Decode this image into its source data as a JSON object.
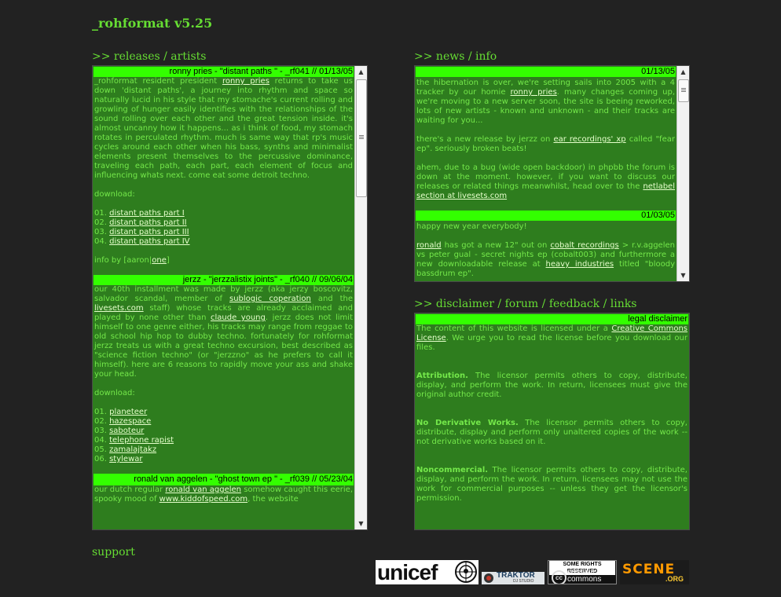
{
  "site": {
    "title": "_rohformat v5.25"
  },
  "sections": {
    "releases": {
      "prefix": ">>",
      "a": "releases",
      "sep": "/",
      "b": "artists"
    },
    "news": {
      "prefix": ">>",
      "a": "news",
      "sep": "/",
      "b": "info"
    },
    "disclaimer": {
      "prefix": ">>",
      "a": "disclaimer",
      "sep1": "/",
      "b": "forum",
      "sep2": "/",
      "c": "feedback",
      "sep3": "/",
      "d": "links"
    }
  },
  "releases": [
    {
      "header": "ronny pries - \"distant paths \" - _rf041 // 01/13/05",
      "p1_a": "_rohformat resident president ",
      "p1_link": "ronny pries",
      "p1_b": " returns to take us down 'distant paths', a journey into rhythm and space so naturally lucid in his style that my stomache's current rolling and growling of hunger easily identifies with the relationships of the sound rolling over each other and the great tension inside. it's almost uncanny how it happens... as i think of food, my stomach rotates in perculated rhythm. much is same way that rp's music cycles around each other when his bass, synths and minimalist elements present themselves to the percussive dominance, traveling each path, each part, each element of focus and influencing whats next. come eat some detroit techno.",
      "download_label": "download:",
      "tracks": [
        {
          "num": "01.",
          "title": "distant paths part I"
        },
        {
          "num": "02.",
          "title": "distant paths part II"
        },
        {
          "num": "03.",
          "title": "distant paths part III"
        },
        {
          "num": "04.",
          "title": "distant paths part IV"
        }
      ],
      "info_a": "info by [aaron|",
      "info_link": "one",
      "info_b": "]"
    },
    {
      "header": "jerzz - \"jerzzalistix joints\" - _rf040 // 09/06/04",
      "p1_a": "our 40th installment was made by jerzz (aka jerzy boscovitz, salvador scandal, member of ",
      "p1_link1": "sublogic coperation",
      "p1_b": " and the ",
      "p1_link2": "livesets.com",
      "p1_c": " staff) whose tracks are already acclaimed and played by none other than ",
      "p1_link3": "claude young",
      "p1_d": ". jerzz does not limit himself to one genre either, his tracks may range from reggae to old school hip hop to dubby techno. fortunately for rohformat jerzz treats us with a great techno excursion, best described as \"science fiction techno\" (or \"jerzzno\" as he prefers to call it himself). here are 6 reasons to rapidly move your ass and shake your head.",
      "download_label": "download:",
      "tracks": [
        {
          "num": "01.",
          "title": "planeteer"
        },
        {
          "num": "02.",
          "title": "hazespace"
        },
        {
          "num": "03.",
          "title": "saboteur"
        },
        {
          "num": "04.",
          "title": "telephone rapist"
        },
        {
          "num": "05.",
          "title": "zamalajtakz"
        },
        {
          "num": "06.",
          "title": "stylewar"
        }
      ]
    },
    {
      "header": "ronald van aggelen - \"ghost town ep \" - _rf039 // 05/23/04",
      "p1_a": "our dutch regular ",
      "p1_link1": "ronald van aggelen",
      "p1_b": " somehow caught this eerie, spooky mood of ",
      "p1_link2": "www.kiddofspeed.com",
      "p1_c": ", the website"
    }
  ],
  "news": [
    {
      "date": "01/13/05",
      "p1_a": "the hibernation is over, we're setting sails into 2005 with a 4 tracker by our homie ",
      "p1_link": "ronny pries",
      "p1_b": ". many changes coming up, we're moving to a new server soon, the site is beeing reworked, lots of new artists - known and unknown - and their tracks are waiting for you...",
      "p2_a": "there's a new release by jerzz on ",
      "p2_link": "ear recordings' xp",
      "p2_b": " called \"fear ep\". seriously broken beats!",
      "p3_a": "ahem, due to a bug (wide open backdoor) in phpbb the forum is down at the moment. however, if you want to discuss our releases or related things meanwhilst, head over to the ",
      "p3_link": "netlabel section at livesets.com"
    },
    {
      "date": "01/03/05",
      "p1": "happy new year everybody!",
      "p2_link1": "ronald",
      "p2_a": " has got a new 12\" out on ",
      "p2_link2": "cobalt recordings",
      "p2_b": " > r.v.aggelen vs peter gual - secret nights ep (cobalt003) and furthermore a new downloadable release at ",
      "p2_link3": "heavy industries",
      "p2_c": " titled \"bloody bassdrum ep\"."
    }
  ],
  "disclaimer": {
    "header": "legal disclaimer",
    "p1_a": "The content of this website is licensed under a ",
    "p1_link": "Creative Commons License",
    "p1_b": ". We urge you to read the license before you download our files.",
    "p2_title": "Attribution.",
    "p2_body": " The licensor permits others to copy, distribute, display, and perform the work. In return, licensees must give the original author credit.",
    "p3_title": "No Derivative Works.",
    "p3_body": " The licensor permits others to copy, distribute, display and perform only unaltered copies of the work -- not derivative works based on it.",
    "p4_title": "Noncommercial.",
    "p4_body": " The licensor permits others to copy, distribute, display, and perform the work. In return, licensees may not use the work for commercial purposes -- unless they get the licensor's permission."
  },
  "support": {
    "label": "support"
  },
  "badges": {
    "unicef": {
      "text": "unicef"
    },
    "traktor": {
      "text": "TRAKTOR",
      "sub": "DJ STUDIO"
    },
    "cc": {
      "top": "SOME RIGHTS RESERVED",
      "main": "creative",
      "main2": "commons",
      "mark": "cc"
    },
    "scene": {
      "text": "SCENE",
      "sub": ".ORG"
    }
  },
  "colors": {
    "background": "#222222",
    "panel": "#2e7d1e",
    "text": "#74e84a",
    "header_bar": "#33ff00",
    "link": "#e6ffcc",
    "heading": "#66dd33"
  },
  "scroll": {
    "releases_position": 0.0,
    "news_position": 0.0
  }
}
